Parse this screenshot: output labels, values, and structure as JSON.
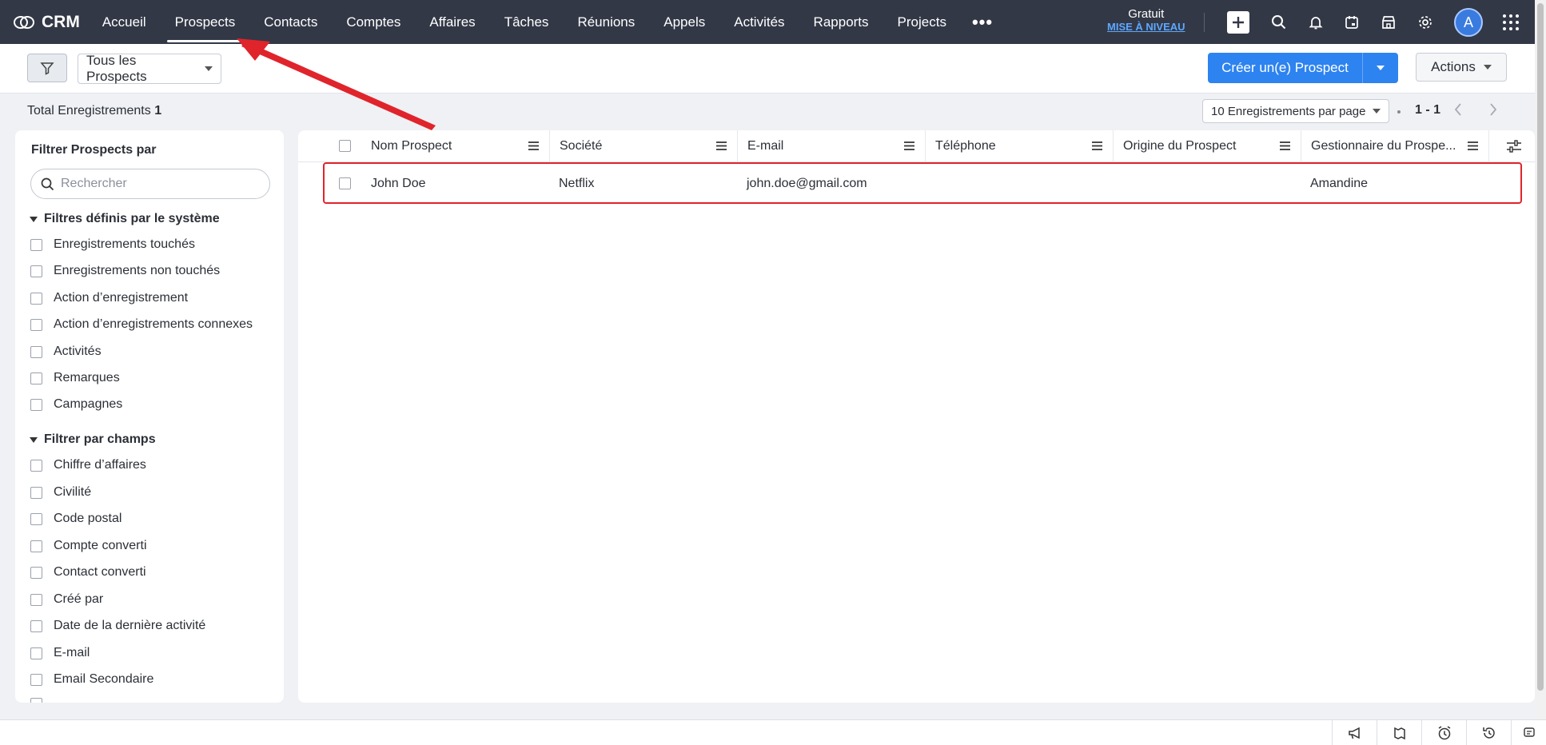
{
  "nav": {
    "brand": "CRM",
    "tabs": [
      "Accueil",
      "Prospects",
      "Contacts",
      "Comptes",
      "Affaires",
      "Tâches",
      "Réunions",
      "Appels",
      "Activités",
      "Rapports",
      "Projects"
    ],
    "more": "•••",
    "plan": "Gratuit",
    "upgrade": "MISE À NIVEAU",
    "avatar": "A"
  },
  "toolbar": {
    "view": "Tous les Prospects",
    "create": "Créer un(e) Prospect",
    "actions": "Actions"
  },
  "info": {
    "total_label": "Total Enregistrements",
    "total_count": "1",
    "per_page": "10 Enregistrements par page",
    "range": "1 - 1"
  },
  "sidebar": {
    "title": "Filtrer Prospects par",
    "search_placeholder": "Rechercher",
    "section1": "Filtres définis par le système",
    "system_filters": [
      "Enregistrements touchés",
      "Enregistrements non touchés",
      "Action d’enregistrement",
      "Action d’enregistrements connexes",
      "Activités",
      "Remarques",
      "Campagnes"
    ],
    "section2": "Filtrer par champs",
    "field_filters": [
      "Chiffre d’affaires",
      "Civilité",
      "Code postal",
      "Compte converti",
      "Contact converti",
      "Créé par",
      "Date de la dernière activité",
      "E-mail",
      "Email Secondaire"
    ]
  },
  "table": {
    "columns": [
      "Nom Prospect",
      "Société",
      "E-mail",
      "Téléphone",
      "Origine du Prospect",
      "Gestionnaire du Prospe..."
    ],
    "rows": [
      {
        "name": "John Doe",
        "company": "Netflix",
        "email": "john.doe@gmail.com",
        "phone": "",
        "source": "",
        "owner": "Amandine"
      }
    ]
  },
  "colors": {
    "nav_bg": "#323846",
    "primary": "#2d83f0",
    "highlight": "#e0242c"
  }
}
